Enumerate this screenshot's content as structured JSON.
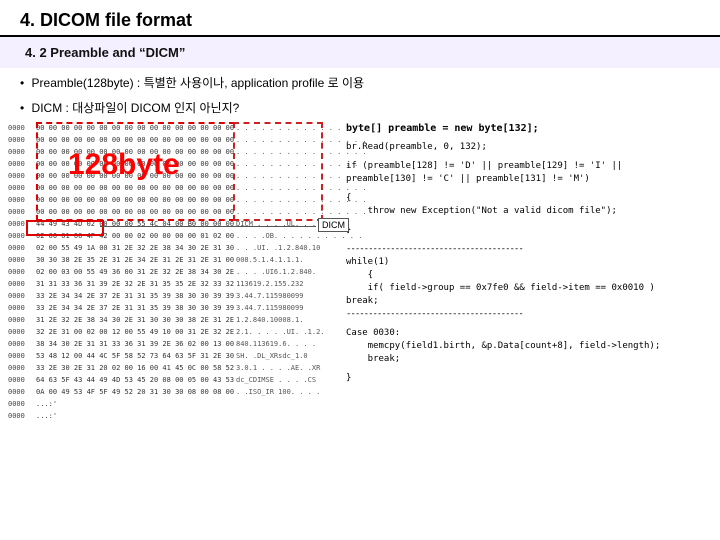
{
  "title": "4. DICOM file format",
  "subtitle": "4. 2 Preamble  and “DICM”",
  "bullet1": "Preamble(128byte) :  특별한 사용이나,  application profile 로 이용",
  "bullet2": "DICM  : 대상파일이 DICOM 인지 아닌지?",
  "label128": "128byte",
  "dicm_label": "DICM",
  "hex": {
    "rows": [
      {
        "addr": "0000",
        "bytes": "00 00 00 00 00 00 00 00 00 00 00 00 00 00 00 00",
        "ascii": ". . . . . . . . . . . . . . . ."
      },
      {
        "addr": "0000",
        "bytes": "00 00 00 00 00 00 00 00 00 00 00 00 00 00 00 00",
        "ascii": ". . . . . . . . . . . . . . . ."
      },
      {
        "addr": "0000",
        "bytes": "00 00 00 00 00 00 00 00 00 00 00 00 00 00 00 00",
        "ascii": ". . . . . . . . . . . . . . . ."
      },
      {
        "addr": "0000",
        "bytes": "00 00 00 00 00 00 00 00 00 00 00 00 00 00 00 00",
        "ascii": ". . . . . . . . . . . . . . . ."
      },
      {
        "addr": "0000",
        "bytes": "00 00 00 00 00 00 00 00 00 00 00 00 00 00 00 00",
        "ascii": ". . . . . . . . . . . . . . . ."
      },
      {
        "addr": "0000",
        "bytes": "00 00 00 00 00 00 00 00 00 00 00 00 00 00 00 00",
        "ascii": ". . . . . . . . . . . . . . . ."
      },
      {
        "addr": "0000",
        "bytes": "00 00 00 00 00 00 00 00 00 00 00 00 00 00 00 00",
        "ascii": ". . . . . . . . . . . . . . . ."
      },
      {
        "addr": "0000",
        "bytes": "00 00 00 00 00 00 00 00 00 00 00 00 00 00 00 00",
        "ascii": ". . . . . . . . . . . . . . . ."
      },
      {
        "addr": "0000",
        "bytes": "44 49 43 4D 02 00 00 00 55 4C 04 00 B0 00 00 00",
        "ascii": "DICM . . . .UL. . . . . ."
      },
      {
        "addr": "0000",
        "bytes": "02 00 01 00 4F 42 00 00 02 00 00 00 00 01 02 00",
        "ascii": ". . . .OB. . . . . . . . . . ."
      },
      {
        "addr": "0000",
        "bytes": "02 00 55 49 1A 00 31 2E 32 2E 38 34 30 2E 31 30",
        "ascii": ". . .UI. .1.2.840.10"
      },
      {
        "addr": "0000",
        "bytes": "30 30 38 2E 35 2E 31 2E 34 2E 31 2E 31 2E 31 00",
        "ascii": "008.5.1.4.1.1.1."
      },
      {
        "addr": "0000",
        "bytes": "02 00 03 00 55 49 36 00 31 2E 32 2E 38 34 30 2E",
        "ascii": ". . . .UI6.1.2.840."
      },
      {
        "addr": "0000",
        "bytes": "31 31 33 36 31 39 2E 32 2E 31 35 35 2E 32 33 32",
        "ascii": "113619.2.155.232"
      },
      {
        "addr": "0000",
        "bytes": "33 2E 34 34 2E 37 2E 31 31 35 39 38 30 30 39 39",
        "ascii": "3.44.7.115980099"
      },
      {
        "addr": "0000",
        "bytes": "33 2E 34 34 2E 37 2E 31 31 35 39 38 30 30 39 39",
        "ascii": "3.44.7.115980099"
      },
      {
        "addr": "0000",
        "bytes": "31 2E 32 2E 38 34 30 2E 31 30 30 30 38 2E 31 2E",
        "ascii": "1.2.840.10008.1."
      },
      {
        "addr": "0000",
        "bytes": "32 2E 31 00 02 00 12 00 55 49 10 00 31 2E 32 2E",
        "ascii": "2.1. . . . .UI. .1.2."
      },
      {
        "addr": "0000",
        "bytes": "38 34 30 2E 31 31 33 36 31 39 2E 36 02 00 13 00",
        "ascii": "840.113619.6. . . ."
      },
      {
        "addr": "0000",
        "bytes": "53 48 12 00 44 4C 5F 58 52 73 64 63 5F 31 2E 30",
        "ascii": "SH. .DL_XRsdc_1.0"
      },
      {
        "addr": "0000",
        "bytes": "33 2E 30 2E 31 20 02 00 16 00 41 45 0C 00 58 52",
        "ascii": "3.0.1 . . . .AE. .XR"
      },
      {
        "addr": "0000",
        "bytes": "64 63 5F 43 44 49 4D 53 45 20 08 00 05 00 43 53",
        "ascii": "dc_CDIMSE . . . .CS"
      },
      {
        "addr": "0000",
        "bytes": "0A 00 49 53 4F 5F 49 52 20 31 30 30 08 00 08 00",
        "ascii": ". .ISO_IR 100. . . ."
      },
      {
        "addr": "0000",
        "bytes": "...:'",
        "ascii": ""
      },
      {
        "addr": "0000",
        "bytes": "...:'",
        "ascii": ""
      }
    ]
  },
  "code": {
    "l1": "byte[] preamble = new byte[132];",
    "l2": "br.Read(preamble, 0, 132);",
    "l3": "if (preamble[128] != 'D' || preamble[129] != 'I' ||",
    "l4": "preamble[130] != 'C' || preamble[131] != 'M')",
    "l5": "{",
    "l6": "    throw new Exception(\"Not a valid dicom file\");",
    "l7": "}",
    "sep1": "----------------------------------------",
    "l8": "while(1)",
    "l9": "    {",
    "l10": "    if( field->group == 0x7fe0 && field->item == 0x0010 )",
    "l11": "break;",
    "sep2": "----------------------------------------",
    "l12": "Case 0030:",
    "l13": "    memcpy(field1.birth, &p.Data[count+8], field->length);",
    "l14": "    break;",
    "l15": "}"
  }
}
